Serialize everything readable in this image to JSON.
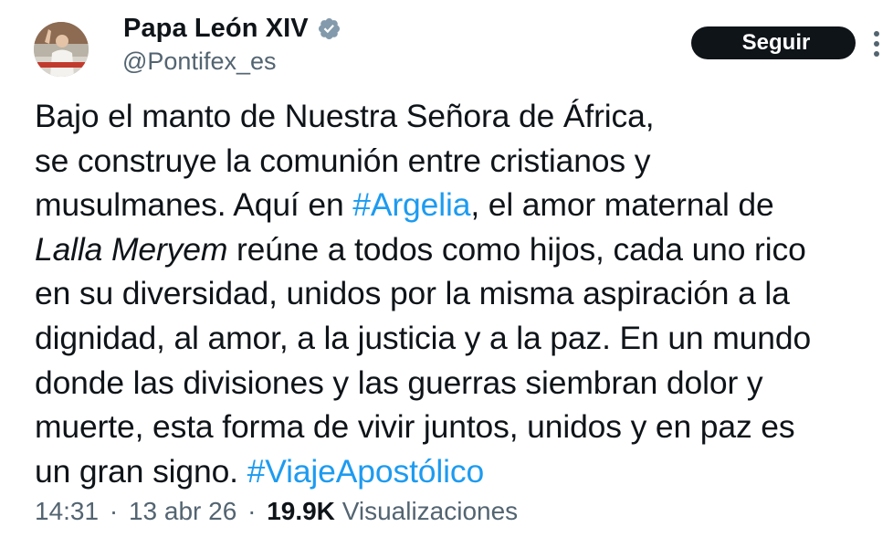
{
  "author": {
    "display_name": "Papa León XIV",
    "handle": "@Pontifex_es",
    "verified_icon": "verified-badge-icon"
  },
  "actions": {
    "follow_label": "Seguir",
    "more_icon": "more-options-icon"
  },
  "tweet": {
    "line1": "Bajo el manto de Nuestra Señora de África,",
    "line2": "se construye la comunión entre cristianos y",
    "line3_a": "musulmanes. Aquí en ",
    "line3_hashtag": "#Argelia",
    "line3_b": ", el amor maternal de",
    "line4_italic": "Lalla Meryem",
    "line4_b": " reúne a todos como hijos, cada uno rico",
    "line5": "en su diversidad, unidos por la misma aspiración a la",
    "line6": "dignidad, al amor, a la justicia y a la paz. En un mundo",
    "line7": "donde las divisiones y las guerras siembran dolor y",
    "line8": "muerte, esta forma de vivir juntos, unidos y en paz es",
    "line9_a": "un gran signo. ",
    "line9_hashtag": "#ViajeApostólico"
  },
  "meta": {
    "time": "14:31",
    "separator": "·",
    "date": "13 abr 26",
    "views_count": "19.9K",
    "views_label": "Visualizaciones"
  },
  "colors": {
    "text": "#0f1419",
    "secondary": "#536471",
    "link": "#1d9bf0",
    "button_bg": "#0f1419",
    "button_text": "#ffffff"
  }
}
